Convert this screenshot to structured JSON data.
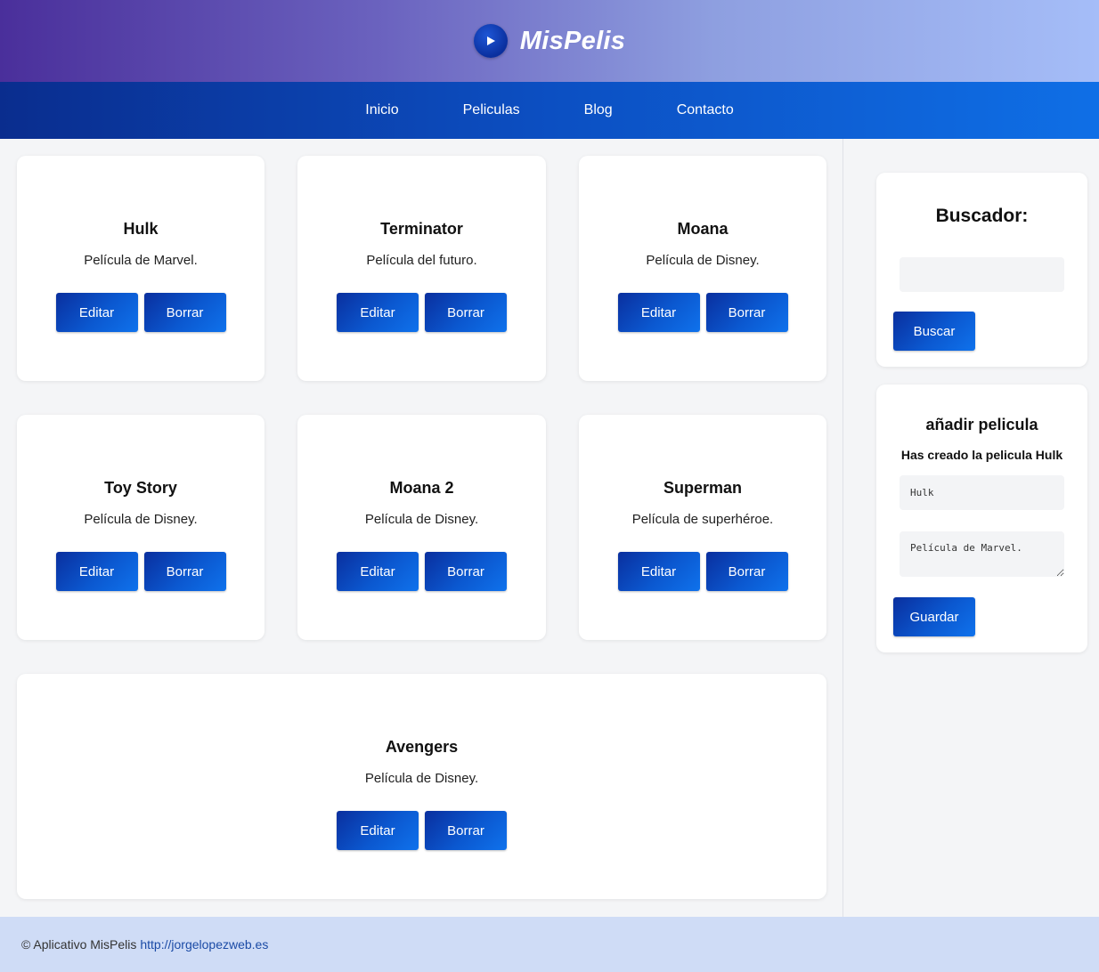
{
  "header": {
    "brand": "MisPelis",
    "logo_icon": "play-circle-icon"
  },
  "nav": {
    "items": [
      "Inicio",
      "Peliculas",
      "Blog",
      "Contacto"
    ]
  },
  "movies": [
    {
      "title": "Hulk",
      "description": "Película de Marvel.",
      "edit_label": "Editar",
      "delete_label": "Borrar"
    },
    {
      "title": "Terminator",
      "description": "Película del futuro.",
      "edit_label": "Editar",
      "delete_label": "Borrar"
    },
    {
      "title": "Moana",
      "description": "Película de Disney.",
      "edit_label": "Editar",
      "delete_label": "Borrar"
    },
    {
      "title": "Toy Story",
      "description": "Película de Disney.",
      "edit_label": "Editar",
      "delete_label": "Borrar"
    },
    {
      "title": "Moana 2",
      "description": "Película de Disney.",
      "edit_label": "Editar",
      "delete_label": "Borrar"
    },
    {
      "title": "Superman",
      "description": "Película de superhéroe.",
      "edit_label": "Editar",
      "delete_label": "Borrar"
    },
    {
      "title": "Avengers",
      "description": "Película de Disney.",
      "edit_label": "Editar",
      "delete_label": "Borrar"
    }
  ],
  "sidebar": {
    "search": {
      "title": "Buscador:",
      "input_value": "",
      "button_label": "Buscar"
    },
    "add_movie": {
      "title": "añadir pelicula",
      "status": "Has creado la pelicula Hulk",
      "title_value": "Hulk",
      "description_value": "Película de Marvel.",
      "button_label": "Guardar"
    }
  },
  "footer": {
    "text": "© Aplicativo MisPelis",
    "link": "http://jorgelopezweb.es"
  },
  "colors": {
    "accent": "#0b4fc6",
    "background": "#f4f5f7",
    "footer_bg": "#cfdcf6"
  }
}
